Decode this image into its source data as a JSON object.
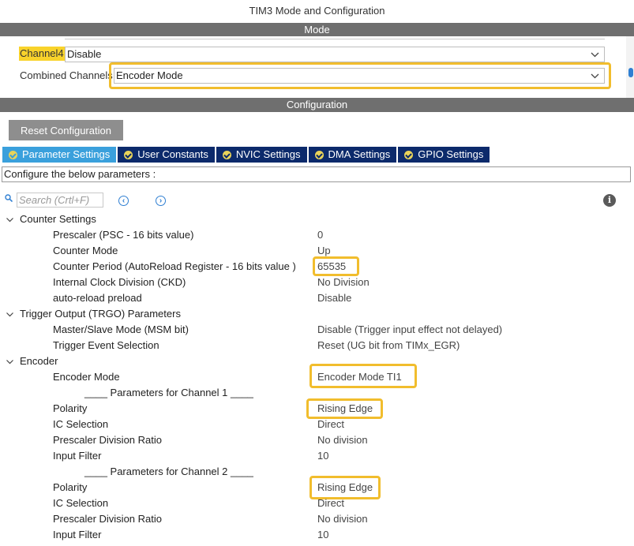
{
  "window": {
    "title": "TIM3 Mode and Configuration"
  },
  "sections": {
    "mode": "Mode",
    "configuration": "Configuration"
  },
  "mode": {
    "channel4": {
      "label": "Channel4",
      "value": "Disable"
    },
    "combined_channels": {
      "label": "Combined Channels",
      "value": "Encoder Mode"
    }
  },
  "reset_button": "Reset Configuration",
  "tabs": [
    {
      "label": "Parameter Settings",
      "active": true
    },
    {
      "label": "User Constants",
      "active": false
    },
    {
      "label": "NVIC Settings",
      "active": false
    },
    {
      "label": "DMA Settings",
      "active": false
    },
    {
      "label": "GPIO Settings",
      "active": false
    }
  ],
  "description": "Configure the below parameters :",
  "search": {
    "placeholder": "Search (Crtl+F)"
  },
  "icons": {
    "search": "search-icon",
    "prev": "chevron-left-circle-icon",
    "next": "chevron-right-circle-icon",
    "info": "info-icon",
    "caret": "chevron-down-icon",
    "check": "check-circle-icon"
  },
  "colors": {
    "header_bar": "#6f6f6f",
    "tab_active": "#3aa0dc",
    "tab_inactive": "#0c2a6b",
    "highlight": "#f1bd2d",
    "channel_highlight": "#f9d32b"
  },
  "params": {
    "counter_settings": {
      "title": "Counter Settings",
      "rows": [
        {
          "name": "Prescaler (PSC - 16 bits value)",
          "value": "0"
        },
        {
          "name": "Counter Mode",
          "value": "Up"
        },
        {
          "name": "Counter Period (AutoReload Register - 16 bits value )",
          "value": "65535"
        },
        {
          "name": "Internal Clock Division (CKD)",
          "value": "No Division"
        },
        {
          "name": "auto-reload preload",
          "value": "Disable"
        }
      ]
    },
    "trgo": {
      "title": "Trigger Output (TRGO) Parameters",
      "rows": [
        {
          "name": "Master/Slave Mode (MSM bit)",
          "value": "Disable (Trigger input effect not delayed)"
        },
        {
          "name": "Trigger Event Selection",
          "value": "Reset (UG bit from TIMx_EGR)"
        }
      ]
    },
    "encoder": {
      "title": "Encoder",
      "mode": {
        "name": "Encoder Mode",
        "value": "Encoder Mode TI1"
      },
      "ch1_header": "____ Parameters for Channel 1 ____",
      "ch1": [
        {
          "name": "Polarity",
          "value": "Rising Edge"
        },
        {
          "name": "IC Selection",
          "value": "Direct"
        },
        {
          "name": "Prescaler Division Ratio",
          "value": "No division"
        },
        {
          "name": "Input Filter",
          "value": "10"
        }
      ],
      "ch2_header": "____ Parameters for Channel 2 ____",
      "ch2": [
        {
          "name": "Polarity",
          "value": "Rising Edge"
        },
        {
          "name": "IC Selection",
          "value": "Direct"
        },
        {
          "name": "Prescaler Division Ratio",
          "value": "No division"
        },
        {
          "name": "Input Filter",
          "value": "10"
        }
      ]
    }
  }
}
